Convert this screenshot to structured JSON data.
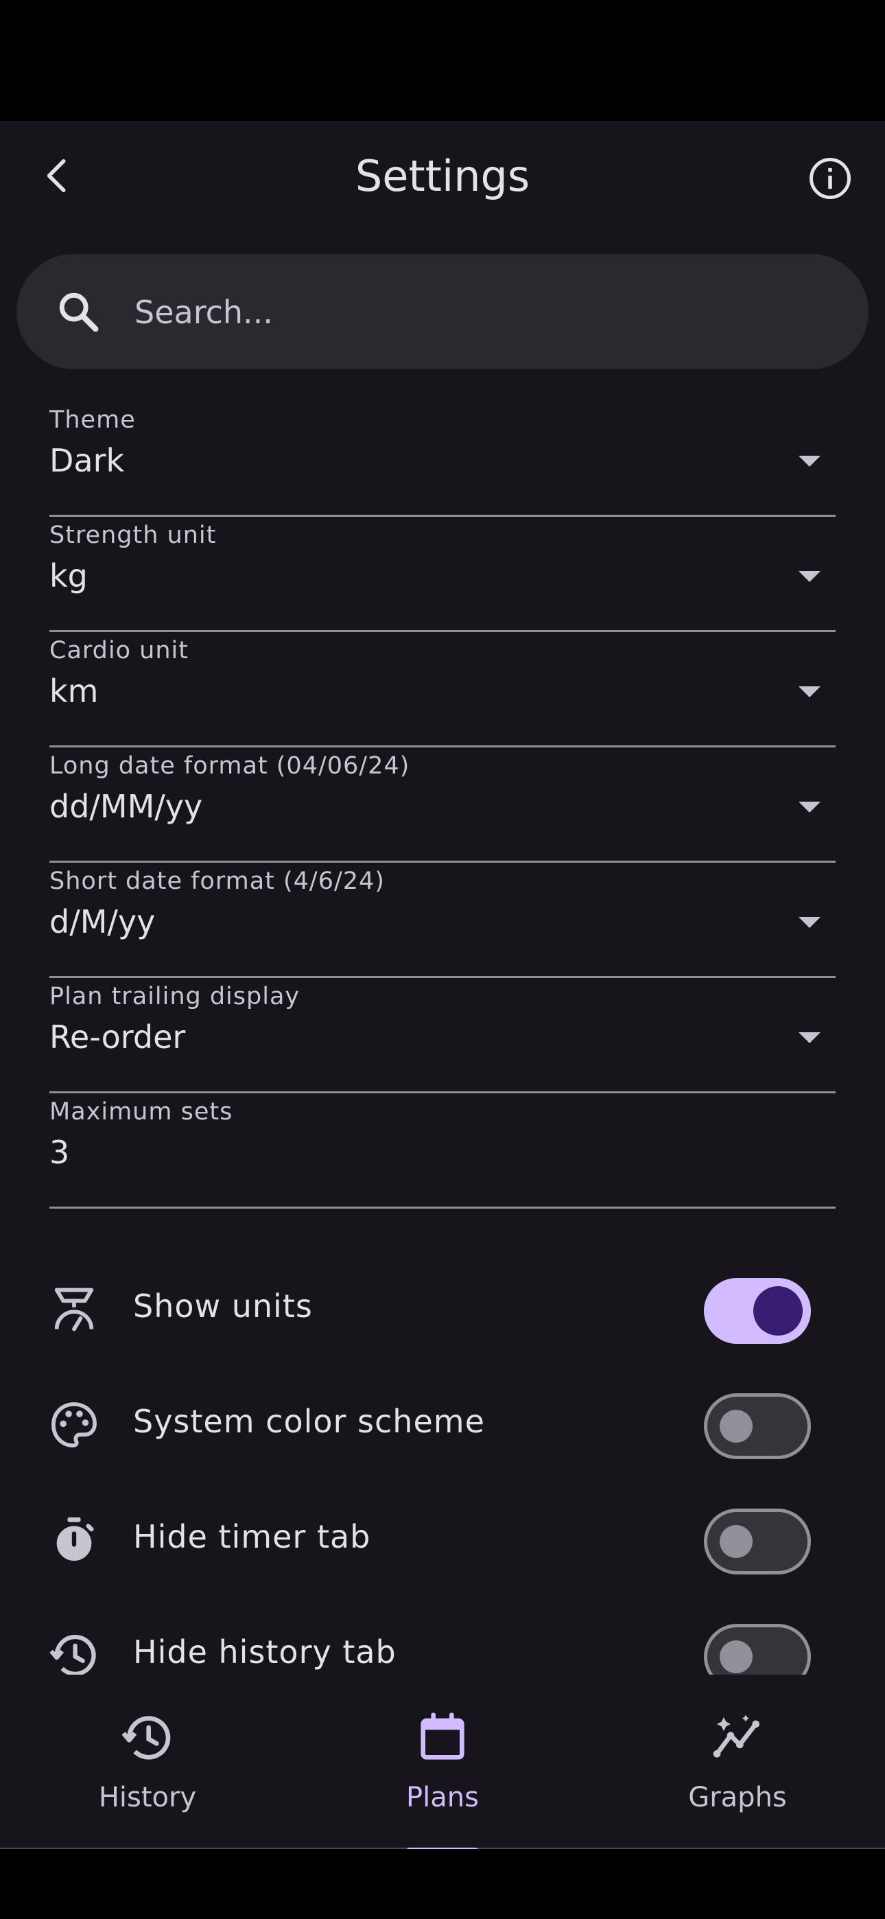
{
  "app_bar": {
    "title": "Settings",
    "back_icon": "arrow-back-icon",
    "info_icon": "info-icon"
  },
  "search": {
    "placeholder": "Search...",
    "value": "",
    "icon": "search-icon"
  },
  "fields": [
    {
      "label": "Theme",
      "value": "Dark",
      "type": "dropdown"
    },
    {
      "label": "Strength unit",
      "value": "kg",
      "type": "dropdown"
    },
    {
      "label": "Cardio unit",
      "value": "km",
      "type": "dropdown"
    },
    {
      "label": "Long date format (04/06/24)",
      "value": "dd/MM/yy",
      "type": "dropdown"
    },
    {
      "label": "Short date format (4/6/24)",
      "value": "d/M/yy",
      "type": "dropdown"
    },
    {
      "label": "Plan trailing display",
      "value": "Re-order",
      "type": "dropdown"
    },
    {
      "label": "Maximum sets",
      "value": "3",
      "type": "number"
    }
  ],
  "toggles": [
    {
      "label": "Show units",
      "icon": "scale-icon",
      "on": true
    },
    {
      "label": "System color scheme",
      "icon": "palette-icon",
      "on": false
    },
    {
      "label": "Hide timer tab",
      "icon": "timer-icon",
      "on": false
    },
    {
      "label": "Hide history tab",
      "icon": "history-icon",
      "on": false
    }
  ],
  "bottom_nav": [
    {
      "label": "History",
      "icon": "history-icon",
      "active": false
    },
    {
      "label": "Plans",
      "icon": "calendar-icon",
      "active": true
    },
    {
      "label": "Graphs",
      "icon": "graph-icon",
      "active": false
    }
  ],
  "colors": {
    "background": "#17151b",
    "accent": "#d0bcff",
    "switch_on_knob": "#381e72",
    "outline": "#938f99",
    "search_bg": "#2b2930"
  }
}
